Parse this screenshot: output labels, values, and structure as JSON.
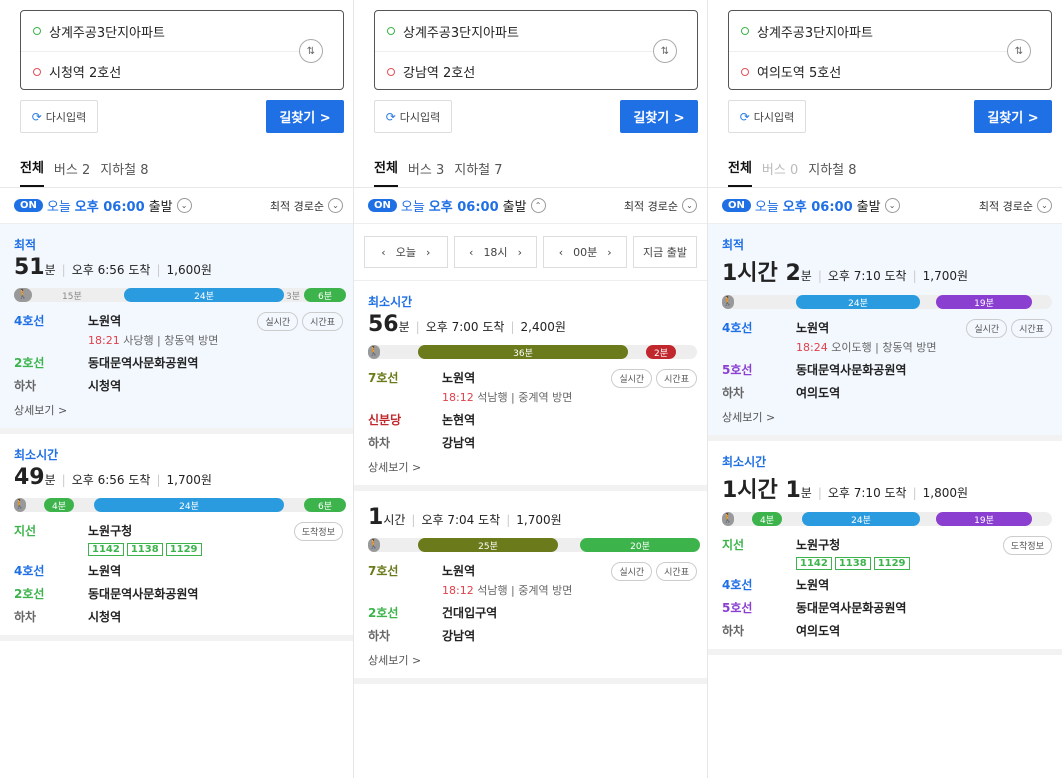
{
  "panels": [
    {
      "from": "상계주공3단지아파트",
      "to": "시청역 2호선",
      "reset_label": "다시입력",
      "go_label": "길찾기 >",
      "tabs": [
        "전체",
        "버스 2",
        "지하철 8"
      ],
      "time": {
        "on": "ON",
        "day": "오늘",
        "ampm_time": "오후 06:00",
        "depart": "출발",
        "sort": "최적 경로순"
      },
      "cards": [
        {
          "tag": "최적",
          "dur": "51",
          "unit": "분",
          "arrive": "오후 6:56 도착",
          "fare": "1,600원",
          "steps": [
            {
              "line": "4호선",
              "color": "#1f6fe5",
              "name": "노원역",
              "sub_time": "18:21",
              "sub": "사당행 | 창동역 방면",
              "chips": [
                "실시간",
                "시간표"
              ]
            },
            {
              "line": "2호선",
              "color": "#3cb44b",
              "name": "동대문역사문화공원역"
            },
            {
              "line": "하차",
              "color": "#666",
              "name": "시청역"
            }
          ],
          "more": "상세보기 >"
        },
        {
          "tag": "최소시간",
          "dur": "49",
          "unit": "분",
          "arrive": "오후 6:56 도착",
          "fare": "1,700원",
          "steps": [
            {
              "line": "지선",
              "color": "#3cb44b",
              "name": "노원구청",
              "chips": [
                "도착정보"
              ],
              "buses": [
                "1142",
                "1138",
                "1129"
              ]
            },
            {
              "line": "4호선",
              "color": "#1f6fe5",
              "name": "노원역"
            },
            {
              "line": "2호선",
              "color": "#3cb44b",
              "name": "동대문역사문화공원역"
            },
            {
              "line": "하차",
              "color": "#666",
              "name": "시청역"
            }
          ]
        }
      ]
    },
    {
      "from": "상계주공3단지아파트",
      "to": "강남역 2호선",
      "reset_label": "다시입력",
      "go_label": "길찾기 >",
      "tabs": [
        "전체",
        "버스 3",
        "지하철 7"
      ],
      "time": {
        "on": "ON",
        "day": "오늘",
        "ampm_time": "오후 06:00",
        "depart": "출발",
        "sort": "최적 경로순"
      },
      "pager": {
        "day": "오늘",
        "hour": "18시",
        "min": "00분",
        "now": "지금 출발"
      },
      "cards": [
        {
          "tag": "최소시간",
          "dur": "56",
          "unit": "분",
          "arrive": "오후 7:00 도착",
          "fare": "2,400원",
          "steps": [
            {
              "line": "7호선",
              "color": "#6b7a1a",
              "name": "노원역",
              "sub_time": "18:12",
              "sub": "석남행 | 중계역 방면",
              "chips": [
                "실시간",
                "시간표"
              ]
            },
            {
              "line": "신분당",
              "color": "#c0282d",
              "name": "논현역"
            },
            {
              "line": "하차",
              "color": "#666",
              "name": "강남역"
            }
          ],
          "more": "상세보기 >"
        },
        {
          "tag": "",
          "dur": "1",
          "unit": "시간",
          "arrive": "오후 7:04 도착",
          "fare": "1,700원",
          "steps": [
            {
              "line": "7호선",
              "color": "#6b7a1a",
              "name": "노원역",
              "sub_time": "18:12",
              "sub": "석남행 | 중계역 방면",
              "chips": [
                "실시간",
                "시간표"
              ]
            },
            {
              "line": "2호선",
              "color": "#3cb44b",
              "name": "건대입구역"
            },
            {
              "line": "하차",
              "color": "#666",
              "name": "강남역"
            }
          ],
          "more": "상세보기 >"
        }
      ]
    },
    {
      "from": "상계주공3단지아파트",
      "to": "여의도역 5호선",
      "reset_label": "다시입력",
      "go_label": "길찾기 >",
      "tabs": [
        "전체",
        "버스 0",
        "지하철 8"
      ],
      "time": {
        "on": "ON",
        "day": "오늘",
        "ampm_time": "오후 06:00",
        "depart": "출발",
        "sort": "최적 경로순"
      },
      "cards": [
        {
          "tag": "최적",
          "dur": "1시간 2",
          "unit": "분",
          "arrive": "오후 7:10 도착",
          "fare": "1,700원",
          "steps": [
            {
              "line": "4호선",
              "color": "#1f6fe5",
              "name": "노원역",
              "sub_time": "18:24",
              "sub": "오이도행 | 창동역 방면",
              "chips": [
                "실시간",
                "시간표"
              ]
            },
            {
              "line": "5호선",
              "color": "#8a3fd1",
              "name": "동대문역사문화공원역"
            },
            {
              "line": "하차",
              "color": "#666",
              "name": "여의도역"
            }
          ],
          "more": "상세보기 >"
        },
        {
          "tag": "최소시간",
          "dur": "1시간 1",
          "unit": "분",
          "arrive": "오후 7:10 도착",
          "fare": "1,800원",
          "steps": [
            {
              "line": "지선",
              "color": "#3cb44b",
              "name": "노원구청",
              "chips": [
                "도착정보"
              ],
              "buses": [
                "1142",
                "1138",
                "1129"
              ]
            },
            {
              "line": "4호선",
              "color": "#1f6fe5",
              "name": "노원역"
            },
            {
              "line": "5호선",
              "color": "#8a3fd1",
              "name": "동대문역사문화공원역"
            },
            {
              "line": "하차",
              "color": "#666",
              "name": "여의도역"
            }
          ]
        }
      ]
    }
  ]
}
